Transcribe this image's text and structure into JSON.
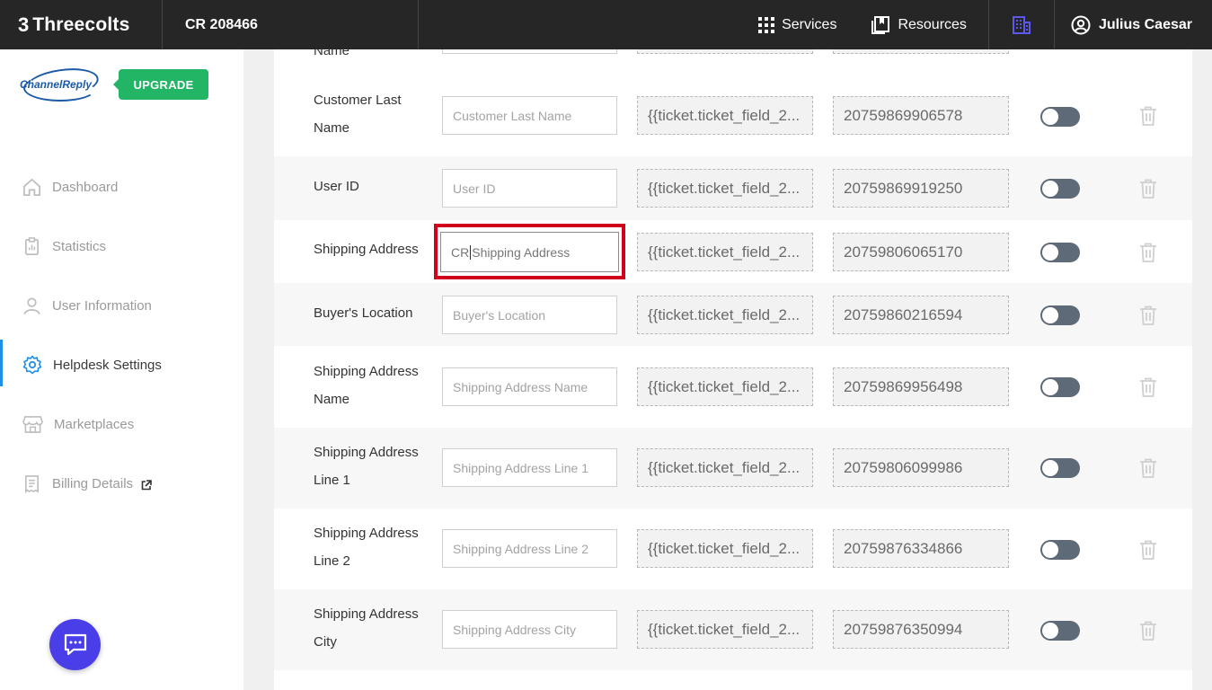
{
  "topbar": {
    "brand_mark": "3",
    "brand_name": "Threecolts",
    "account": "CR 208466",
    "services_label": "Services",
    "resources_label": "Resources",
    "user_name": "Julius Caesar"
  },
  "sidebar": {
    "logo_text": "ChannelReply",
    "upgrade_label": "UPGRADE",
    "items": [
      {
        "label": "Dashboard",
        "icon": "home-icon"
      },
      {
        "label": "Statistics",
        "icon": "clipboard-icon"
      },
      {
        "label": "User Information",
        "icon": "user-icon"
      },
      {
        "label": "Helpdesk Settings",
        "icon": "gear-icon",
        "active": true
      },
      {
        "label": "Marketplaces",
        "icon": "store-icon"
      },
      {
        "label": "Billing Details",
        "icon": "receipt-icon",
        "external": true
      }
    ]
  },
  "fields": {
    "top_partial_label": "Name",
    "rows": [
      {
        "label": "Customer Last Name",
        "value": "",
        "placeholder": "Customer Last Name",
        "template": "{{ticket.ticket_field_2...",
        "field_id": "20759869906578"
      },
      {
        "label": "User ID",
        "value": "",
        "placeholder": "User ID",
        "template": "{{ticket.ticket_field_2...",
        "field_id": "20759869919250"
      },
      {
        "label": "Shipping Address",
        "value_before_caret": "CR",
        "value_after_caret": "Shipping Address",
        "template": "{{ticket.ticket_field_2...",
        "field_id": "20759806065170"
      },
      {
        "label": "Buyer's Location",
        "value": "",
        "placeholder": "Buyer's Location",
        "template": "{{ticket.ticket_field_2...",
        "field_id": "20759860216594"
      },
      {
        "label": "Shipping Address Name",
        "value": "",
        "placeholder": "Shipping Address Name",
        "template": "{{ticket.ticket_field_2...",
        "field_id": "20759869956498"
      },
      {
        "label": "Shipping Address Line 1",
        "value": "",
        "placeholder": "Shipping Address Line 1",
        "template": "{{ticket.ticket_field_2...",
        "field_id": "20759806099986"
      },
      {
        "label": "Shipping Address Line 2",
        "value": "",
        "placeholder": "Shipping Address Line 2",
        "template": "{{ticket.ticket_field_2...",
        "field_id": "20759876334866"
      },
      {
        "label": "Shipping Address City",
        "value": "",
        "placeholder": "Shipping Address City",
        "template": "{{ticket.ticket_field_2...",
        "field_id": "20759876350994"
      }
    ]
  },
  "colors": {
    "topbar": "#262626",
    "upgrade": "#22b566",
    "active_accent": "#1f8fe8",
    "chat_button": "#4a3ee8",
    "highlight": "#d0021b",
    "toggle_off": "#5e6a78"
  }
}
